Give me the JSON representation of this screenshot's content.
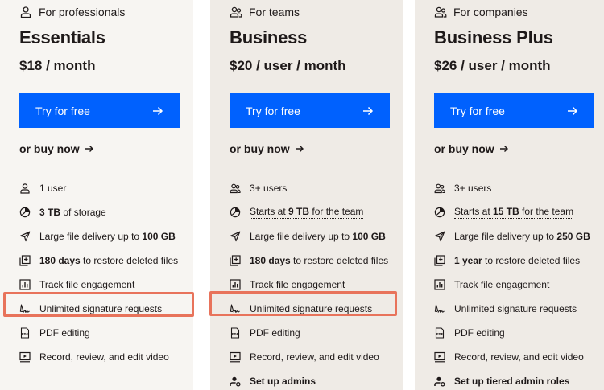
{
  "plans": [
    {
      "audience": "For professionals",
      "name": "Essentials",
      "price": "$18 / month",
      "cta": "Try for free",
      "buy": "or buy now",
      "features": [
        {
          "icon": "user-icon",
          "pre": "1 user"
        },
        {
          "icon": "clock-icon",
          "bold": "3 TB",
          "post": " of storage"
        },
        {
          "icon": "send-icon",
          "pre": "Large file delivery up to ",
          "bold": "100 GB"
        },
        {
          "icon": "restore-icon",
          "bold": "180 days",
          "post": " to restore deleted files"
        },
        {
          "icon": "chart-icon",
          "pre": "Track file engagement"
        },
        {
          "icon": "signature-icon",
          "pre": "Unlimited signature requests"
        },
        {
          "icon": "pdf-icon",
          "pre": "PDF editing"
        },
        {
          "icon": "video-icon",
          "pre": "Record, review, and edit video"
        }
      ]
    },
    {
      "audience": "For teams",
      "name": "Business",
      "price": "$20 / user / month",
      "cta": "Try for free",
      "buy": "or buy now",
      "features": [
        {
          "icon": "users-icon",
          "pre": "3+ users"
        },
        {
          "icon": "clock-icon",
          "pre": "Starts at ",
          "bold": "9 TB",
          "post": " for the team",
          "dotted": true
        },
        {
          "icon": "send-icon",
          "pre": "Large file delivery up to ",
          "bold": "100 GB"
        },
        {
          "icon": "restore-icon",
          "bold": "180 days",
          "post": " to restore deleted files"
        },
        {
          "icon": "chart-icon",
          "pre": "Track file engagement"
        },
        {
          "icon": "signature-icon",
          "pre": "Unlimited signature requests"
        },
        {
          "icon": "pdf-icon",
          "pre": "PDF editing"
        },
        {
          "icon": "video-icon",
          "pre": "Record, review, and edit video"
        },
        {
          "icon": "admin-icon",
          "bold": "Set up admins"
        }
      ]
    },
    {
      "audience": "For companies",
      "name": "Business Plus",
      "price": "$26 / user / month",
      "cta": "Try for free",
      "buy": "or buy now",
      "features": [
        {
          "icon": "users-icon",
          "pre": "3+ users"
        },
        {
          "icon": "clock-icon",
          "pre": "Starts at ",
          "bold": "15 TB",
          "post": " for the team",
          "dotted": true
        },
        {
          "icon": "send-icon",
          "pre": "Large file delivery up to ",
          "bold": "250 GB"
        },
        {
          "icon": "restore-icon",
          "bold": "1 year",
          "post": " to restore deleted files"
        },
        {
          "icon": "chart-icon",
          "pre": "Track file engagement"
        },
        {
          "icon": "signature-icon",
          "pre": "Unlimited signature requests"
        },
        {
          "icon": "pdf-icon",
          "pre": "PDF editing"
        },
        {
          "icon": "video-icon",
          "pre": "Record, review, and edit video"
        },
        {
          "icon": "admin-icon",
          "bold": "Set up tiered admin roles"
        }
      ]
    }
  ],
  "colors": {
    "accent": "#0061fe",
    "highlight": "#e8735b",
    "card_light": "#f7f5f2",
    "card": "#efebe6",
    "text": "#1e1919"
  }
}
